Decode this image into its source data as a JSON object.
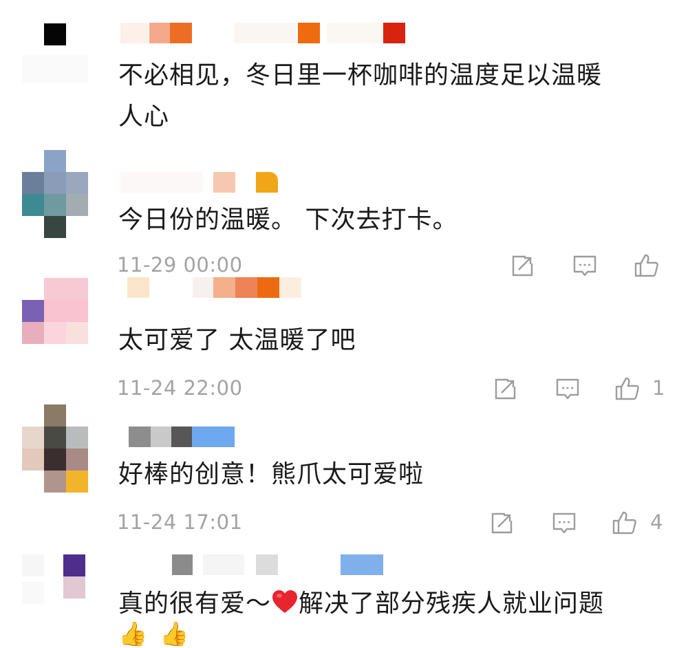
{
  "comments": [
    {
      "text_line1": "不必相见，冬日里一杯咖啡的温度足以温暖",
      "text_line2": "人心"
    },
    {
      "text_line1": "今日份的温暖。 下次去打卡。",
      "time": "11-29 00:00",
      "likes": ""
    },
    {
      "text_line1": "太可爱了 太温暖了吧",
      "time": "11-24 22:00",
      "likes": "1"
    },
    {
      "text_line1": "好棒的创意！熊爪太可爱啦",
      "time": "11-24 17:01",
      "likes": "4"
    },
    {
      "text_before_emoji": "真的很有爱～",
      "text_after_emoji": "解决了部分残疾人就业问题",
      "trailing_emoji": "👍👍"
    }
  ],
  "icons": {
    "share": "share-icon",
    "reply": "comment-icon",
    "like": "thumbs-up-icon",
    "emoji": "red-heart-icon"
  },
  "colors": {
    "meta_gray": "#a3a3a3",
    "text": "#1a1a1a",
    "heart": "#e8242f"
  }
}
